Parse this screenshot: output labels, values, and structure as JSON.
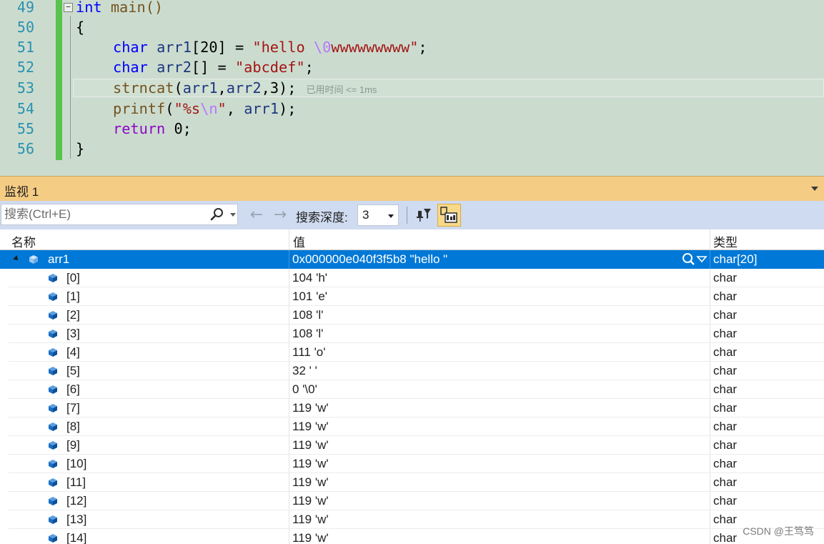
{
  "editor": {
    "lines": [
      {
        "no": "49"
      },
      {
        "no": "50"
      },
      {
        "no": "51"
      },
      {
        "no": "52"
      },
      {
        "no": "53"
      },
      {
        "no": "54"
      },
      {
        "no": "55"
      },
      {
        "no": "56"
      }
    ],
    "collapse_glyph": "−",
    "perf_tip": "已用时间 <= 1ms",
    "code": {
      "l49_kw": "int",
      "l49_rest": " main()",
      "l50": "{",
      "l51_kw": "char",
      "l51_var": "arr1",
      "l51_mid": "[20] = ",
      "l51_str1": "\"hello ",
      "l51_esc": "\\0",
      "l51_str2": "wwwwwwwww\"",
      "l51_end": ";",
      "l52_kw": "char",
      "l52_var": "arr2",
      "l52_mid": "[] = ",
      "l52_str": "\"abcdef\"",
      "l52_end": ";",
      "l53_fn": "strncat",
      "l53_p1": "(",
      "l53_a1": "arr1",
      "l53_c1": ",",
      "l53_a2": "arr2",
      "l53_rest": ",3);",
      "l54_fn": "printf",
      "l54_p1": "(",
      "l54_str1": "\"%s",
      "l54_esc": "\\n",
      "l54_str2": "\"",
      "l54_c": ", ",
      "l54_a": "arr1",
      "l54_end": ");",
      "l55_kw": "return",
      "l55_rest": " 0;",
      "l56": "}"
    }
  },
  "watch": {
    "title": "监视 1",
    "search_placeholder": "搜索(Ctrl+E)",
    "depth_label": "搜索深度:",
    "depth_value": "3",
    "columns": {
      "name": "名称",
      "value": "值",
      "type": "类型"
    },
    "root": {
      "name": "arr1",
      "value": "0x000000e040f3f5b8 \"hello \"",
      "type": "char[20]"
    },
    "rows": [
      {
        "name": "[0]",
        "value": "104 'h'",
        "type": "char"
      },
      {
        "name": "[1]",
        "value": "101 'e'",
        "type": "char"
      },
      {
        "name": "[2]",
        "value": "108 'l'",
        "type": "char"
      },
      {
        "name": "[3]",
        "value": "108 'l'",
        "type": "char"
      },
      {
        "name": "[4]",
        "value": "111 'o'",
        "type": "char"
      },
      {
        "name": "[5]",
        "value": "32 ' '",
        "type": "char"
      },
      {
        "name": "[6]",
        "value": "0 '\\0'",
        "type": "char"
      },
      {
        "name": "[7]",
        "value": "119 'w'",
        "type": "char"
      },
      {
        "name": "[8]",
        "value": "119 'w'",
        "type": "char"
      },
      {
        "name": "[9]",
        "value": "119 'w'",
        "type": "char"
      },
      {
        "name": "[10]",
        "value": "119 'w'",
        "type": "char"
      },
      {
        "name": "[11]",
        "value": "119 'w'",
        "type": "char"
      },
      {
        "name": "[12]",
        "value": "119 'w'",
        "type": "char"
      },
      {
        "name": "[13]",
        "value": "119 'w'",
        "type": "char"
      },
      {
        "name": "[14]",
        "value": "119 'w'",
        "type": "char"
      }
    ]
  },
  "watermark": "CSDN @王笃笃",
  "colors": {
    "accent": "#0078d7",
    "title_bar": "#f5cc84",
    "toolbar": "#cfdbf0",
    "editor_bg": "#cbdccf"
  }
}
